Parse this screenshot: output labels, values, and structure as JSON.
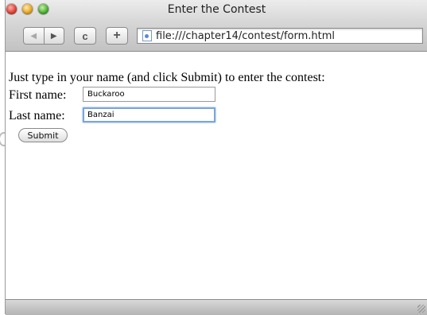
{
  "window": {
    "title": "Enter the Contest"
  },
  "toolbar": {
    "back_icon": "back-arrow-icon",
    "forward_icon": "forward-arrow-icon",
    "reload_glyph": "c",
    "add_glyph": "+",
    "url": "file:///chapter14/contest/form.html"
  },
  "form": {
    "intro": "Just type in your name (and click Submit) to enter the contest:",
    "first_label": "First name:",
    "first_value": "Buckaroo",
    "last_label": "Last name:",
    "last_value": "Banzai",
    "submit_label": "Submit"
  }
}
